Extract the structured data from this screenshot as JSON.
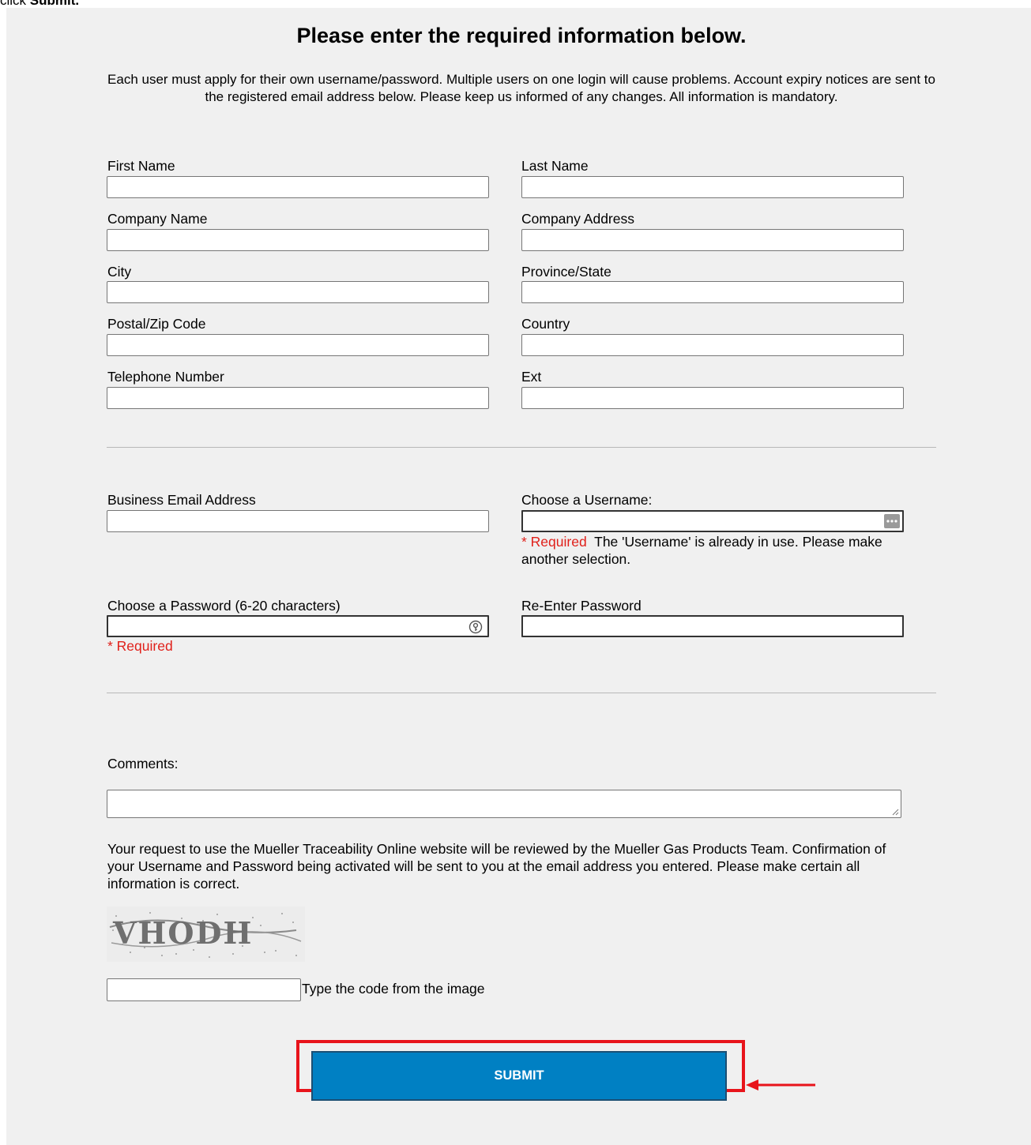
{
  "caption": {
    "prefix": "click",
    "bold": "Submit."
  },
  "title": "Please enter the required information below.",
  "intro": "Each user must apply for their own username/password.  Multiple users on one login will cause problems.  Account expiry notices are sent to the registered email address below.  Please keep us informed of any changes. All information is mandatory.",
  "fields": {
    "first_name": "First Name",
    "last_name": "Last Name",
    "company_name": "Company Name",
    "company_address": "Company Address",
    "city": "City",
    "province_state": "Province/State",
    "postal_code": "Postal/Zip Code",
    "country": "Country",
    "telephone": "Telephone Number",
    "ext": "Ext",
    "business_email": "Business Email Address",
    "username": "Choose a Username:",
    "password": "Choose a Password (6-20 characters)",
    "reenter_password": "Re-Enter Password",
    "comments": "Comments:"
  },
  "validation": {
    "required": "* Required",
    "username_error": "The 'Username' is already in use. Please make another selection.",
    "password_required": "* Required"
  },
  "notice": "Your request to use the Mueller Traceability Online website will be reviewed by the Mueller Gas Products Team. Confirmation of your Username and Password being activated will be sent to you at the email address you entered. Please make certain all information is correct.",
  "captcha": {
    "code": "VHODH",
    "label": "Type the code from the image"
  },
  "submit_label": "SUBMIT",
  "colors": {
    "required": "#e0201a",
    "submit_bg": "#0080c3",
    "highlight": "#e8141b",
    "panel": "#f0f0f0"
  }
}
